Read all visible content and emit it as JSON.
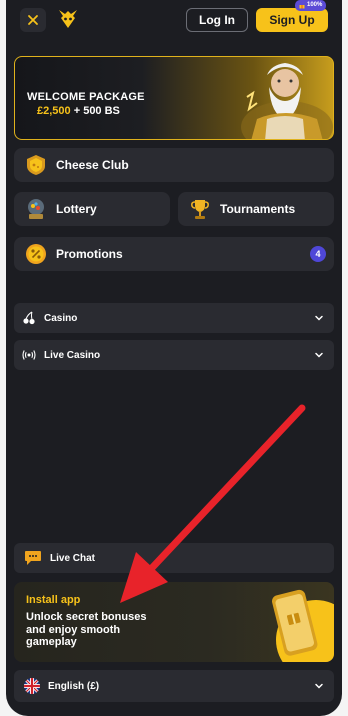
{
  "header": {
    "login_label": "Log In",
    "signup_label": "Sign Up",
    "signup_badge": "100%"
  },
  "banner": {
    "title": "WELCOME PACKAGE",
    "amount": "£2,500",
    "plus": "+ 500 BS"
  },
  "menu": {
    "cheese_club": "Cheese Club",
    "lottery": "Lottery",
    "tournaments": "Tournaments",
    "promotions": "Promotions",
    "promotions_count": "4",
    "casino": "Casino",
    "live_casino": "Live Casino",
    "live_chat": "Live Chat"
  },
  "install": {
    "title": "Install app",
    "text": "Unlock secret bonuses and enjoy smooth gameplay"
  },
  "language": {
    "label": "English (£)"
  },
  "colors": {
    "background": "#1c1d22",
    "tile": "#2a2b31",
    "accent_yellow": "#f7c21a",
    "badge_purple": "#4f47d8",
    "arrow_red": "#e8232a"
  }
}
